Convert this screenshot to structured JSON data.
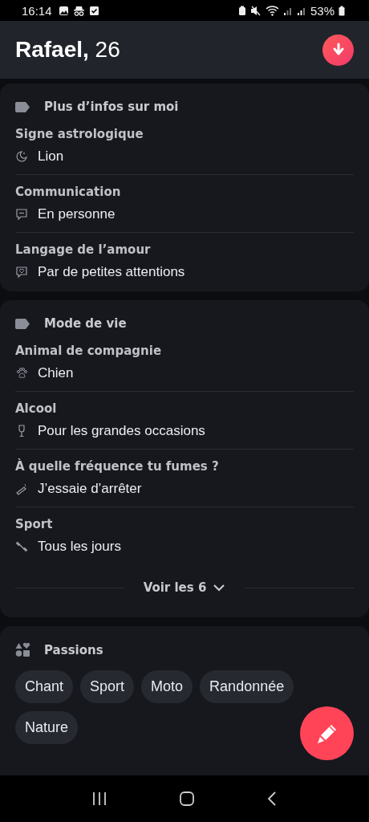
{
  "status_bar": {
    "time": "16:14",
    "battery": "53%"
  },
  "header": {
    "name": "Rafael,",
    "age": "26"
  },
  "sections": [
    {
      "title": "Plus d’infos sur moi",
      "rows": [
        {
          "label": "Signe astrologique",
          "value": "Lion",
          "kind": "zodiac"
        },
        {
          "label": "Communication",
          "value": "En personne",
          "kind": "chat"
        },
        {
          "label": "Langage de l’amour",
          "value": "Par de petites attentions",
          "kind": "heart"
        }
      ]
    },
    {
      "title": "Mode de vie",
      "rows": [
        {
          "label": "Animal de compagnie",
          "value": "Chien",
          "kind": "pet"
        },
        {
          "label": "Alcool",
          "value": "Pour les grandes occasions",
          "kind": "drink"
        },
        {
          "label": "À quelle fréquence tu fumes ?",
          "value": "J’essaie d’arrêter",
          "kind": "smoke"
        },
        {
          "label": "Sport",
          "value": "Tous les jours",
          "kind": "sport"
        }
      ],
      "more": "Voir les 6"
    }
  ],
  "passions": {
    "title": "Passions",
    "chips": [
      "Chant",
      "Sport",
      "Moto",
      "Randonnée",
      "Nature"
    ]
  }
}
